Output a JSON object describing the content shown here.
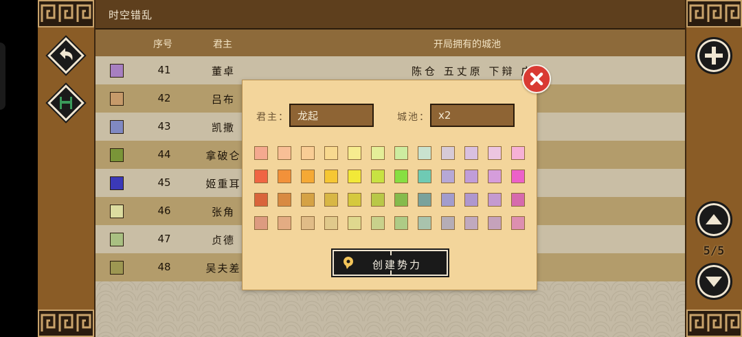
{
  "title": "时空错乱",
  "columns": {
    "color": "",
    "number": "序号",
    "lord": "君主",
    "cities": "开局拥有的城池"
  },
  "rows": [
    {
      "color": "#a77fc1",
      "number": "41",
      "lord": "董卓",
      "cities": "陈仓 五丈原 下辩 广元"
    },
    {
      "color": "#c69a6a",
      "number": "42",
      "lord": "吕布",
      "cities": ""
    },
    {
      "color": "#8089c2",
      "number": "43",
      "lord": "凯撒",
      "cities": ""
    },
    {
      "color": "#7a9538",
      "number": "44",
      "lord": "拿破仑",
      "cities": ""
    },
    {
      "color": "#3b39b8",
      "number": "45",
      "lord": "姬重耳",
      "cities": ""
    },
    {
      "color": "#dcdca0",
      "number": "46",
      "lord": "张角",
      "cities": ""
    },
    {
      "color": "#a9c082",
      "number": "47",
      "lord": "贞德",
      "cities": ""
    },
    {
      "color": "#9d9752",
      "number": "48",
      "lord": "吴夫差",
      "cities": ""
    }
  ],
  "pagination": {
    "current": "5",
    "total": "5",
    "label": "5/5"
  },
  "icons": {
    "back": "undo-arrow-icon",
    "save": "save-disk-icon",
    "add": "plus-icon",
    "up": "triangle-up-icon",
    "down": "triangle-down-icon",
    "close": "close-icon",
    "create": "location-pin-icon"
  },
  "dialog": {
    "lord_label": "君主：",
    "lord_value": "龙起",
    "city_label": "城池：",
    "city_value": "x2",
    "create_button": "创建势力",
    "palette": [
      [
        "#f4a98f",
        "#f8bf96",
        "#f9cd95",
        "#f8d98f",
        "#f6ec8f",
        "#e4ee98",
        "#cdeca0",
        "#c9e2cf",
        "#d6cad7",
        "#d9c0e0",
        "#ecc5e1",
        "#f6b1d6"
      ],
      [
        "#f06543",
        "#f2913a",
        "#f5a935",
        "#f6c733",
        "#f2e938",
        "#c8e242",
        "#87df42",
        "#6fcab4",
        "#b6a8d6",
        "#c09dd9",
        "#d59ddb",
        "#ec61c9"
      ],
      [
        "#d9643b",
        "#d88a42",
        "#d5a245",
        "#d8b745",
        "#d5c93e",
        "#b9c848",
        "#85bb4c",
        "#7aa29c",
        "#a29ccd",
        "#af97ce",
        "#c49ad0",
        "#d66aad"
      ],
      [
        "#dd9b80",
        "#e3ac83",
        "#e0bc87",
        "#e0c98b",
        "#dfd88e",
        "#c8d18b",
        "#aecb86",
        "#a9c3ad",
        "#b5adb6",
        "#c0a9bf",
        "#c5a2bb",
        "#dd8fb0"
      ]
    ]
  },
  "colors": {
    "accent_close": "#d93a33",
    "panel_brown": "#8a5c26",
    "dialog_bg": "#f3d59b"
  }
}
